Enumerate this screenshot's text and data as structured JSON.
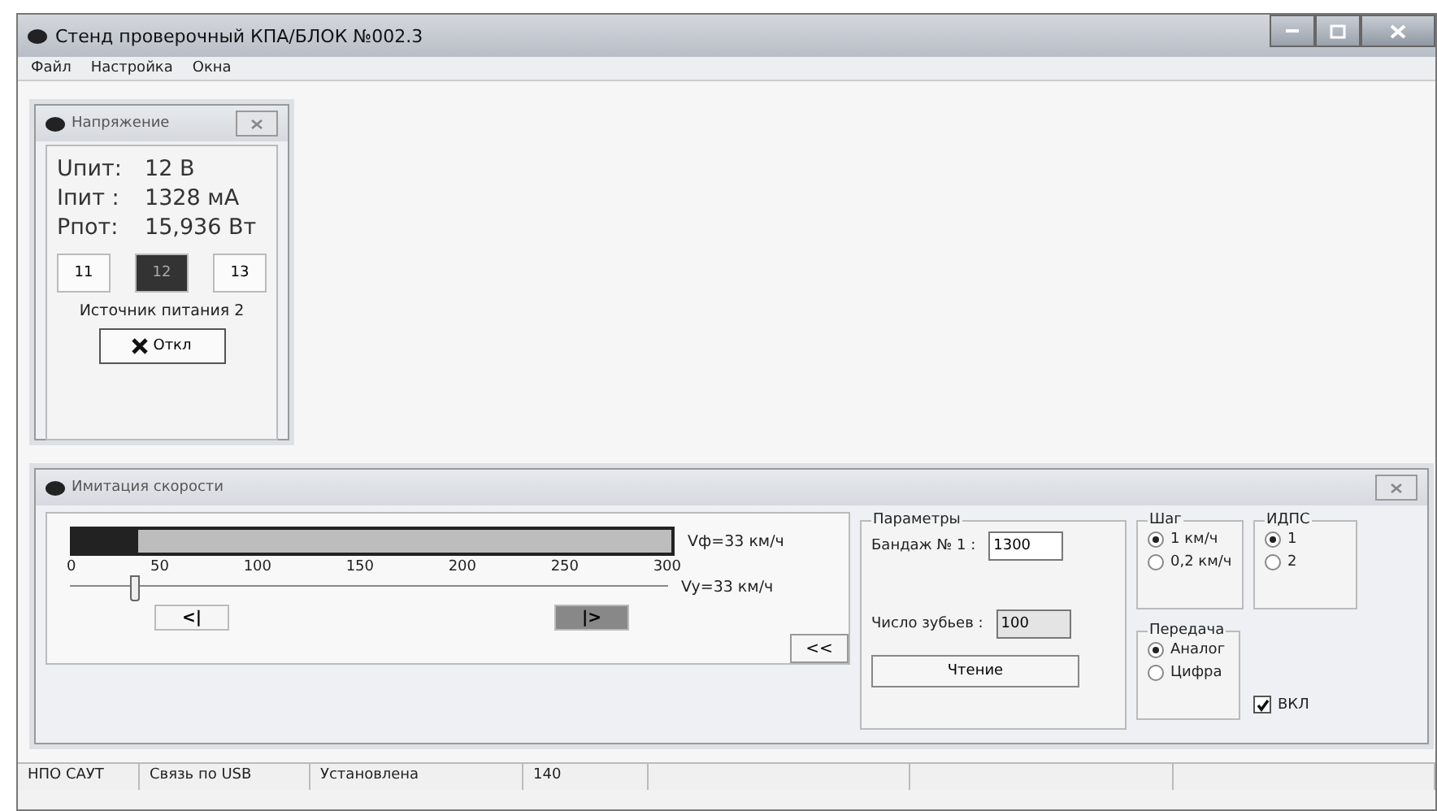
{
  "window": {
    "title": "Стенд проверочный КПА/БЛОК №002.3"
  },
  "menu": [
    "Файл",
    "Настройка",
    "Окна"
  ],
  "voltage_panel": {
    "title": "Напряжение",
    "readings": [
      {
        "label": "Uпит:",
        "value": "12 В"
      },
      {
        "label": "Iпит :",
        "value": "1328 мА"
      },
      {
        "label": "Pпот:",
        "value": "15,936 Вт"
      }
    ],
    "sources": [
      {
        "label": "11",
        "selected": false
      },
      {
        "label": "12",
        "selected": true
      },
      {
        "label": "13",
        "selected": false
      }
    ],
    "source_label": "Источник питания 2",
    "off_button": "Откл"
  },
  "speed_panel": {
    "title": "Имитация скорости",
    "actual_bar": {
      "level": 0.11
    },
    "scale": [
      "0",
      "50",
      "100",
      "150",
      "200",
      "250",
      "300"
    ],
    "actual_reading": "Vф=33 км/ч",
    "slider": {
      "level": 0.11
    },
    "set_reading": "Vy=33 км/ч",
    "nav_buttons": [
      {
        "label": "<|",
        "pressed": false
      },
      {
        "label": "|>",
        "pressed": true
      }
    ],
    "collapse_button": "<<",
    "params": {
      "title": "Параметры",
      "bandage_label": "Бандаж № 1 :",
      "bandage_value": "1300",
      "teeth_label": "Число зубьев :",
      "teeth_value": "100",
      "read_button": "Чтение"
    },
    "step": {
      "title": "Шаг",
      "options": [
        {
          "label": "1 км/ч",
          "selected": true
        },
        {
          "label": "0,2 км/ч",
          "selected": false
        }
      ]
    },
    "idps": {
      "title": "ИДПС",
      "options": [
        {
          "label": "1",
          "selected": true
        },
        {
          "label": "2",
          "selected": false
        }
      ]
    },
    "transfer": {
      "title": "Передача",
      "options": [
        {
          "label": "Аналог",
          "selected": true
        },
        {
          "label": "Цифра",
          "selected": false
        }
      ]
    },
    "enable": {
      "label": "ВКЛ",
      "checked": true
    }
  },
  "status_bar": [
    "НПО САУТ",
    "Связь по USB",
    "Установлена",
    "140"
  ]
}
